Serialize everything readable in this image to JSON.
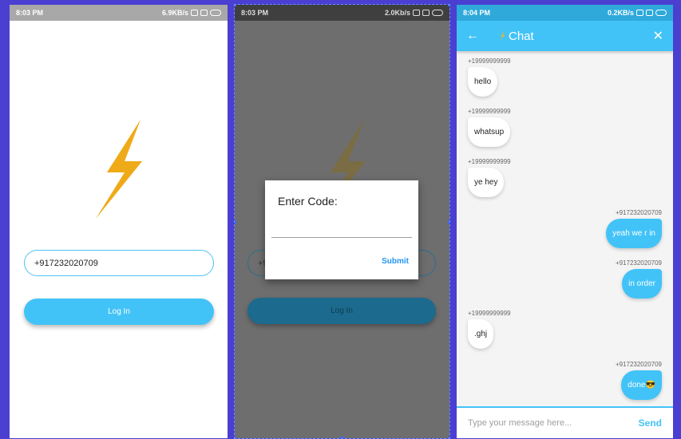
{
  "screen1": {
    "status_time": "8:03 PM",
    "status_speed": "6.9KB/s",
    "phone_value": "+917232020709",
    "login_label": "Log In"
  },
  "screen2": {
    "status_time": "8:03 PM",
    "status_speed": "2.0Kb/s",
    "phone_value_partial": "+9",
    "login_label": "Log In",
    "dialog": {
      "title": "Enter Code:",
      "submit_label": "Submit"
    }
  },
  "screen3": {
    "status_time": "8:04 PM",
    "status_speed": "0.2KB/s",
    "title": "Chat",
    "messages": [
      {
        "sender": "+19999999999",
        "text": "hello",
        "side": "left"
      },
      {
        "sender": "+19999999999",
        "text": "whatsup",
        "side": "left"
      },
      {
        "sender": "+19999999999",
        "text": "ye hey",
        "side": "left"
      },
      {
        "sender": "+917232020709",
        "text": "yeah we r in",
        "side": "right"
      },
      {
        "sender": "+917232020709",
        "text": "in order",
        "side": "right"
      },
      {
        "sender": "+19999999999",
        "text": ".ghj",
        "side": "left"
      },
      {
        "sender": "+917232020709",
        "text": "done😎",
        "side": "right"
      }
    ],
    "input_placeholder": "Type your message here...",
    "send_label": "Send"
  },
  "colors": {
    "accent": "#42c3f7",
    "background": "#4a3fd0",
    "bolt": "#f6b21b"
  }
}
